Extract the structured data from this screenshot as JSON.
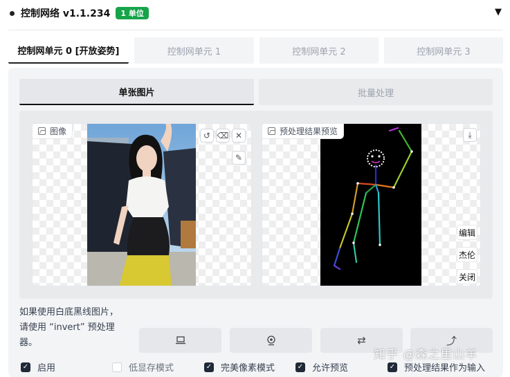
{
  "header": {
    "title": "控制网络 v1.1.234",
    "badge": "1 单位",
    "collapse_icon": "triangle-down-icon"
  },
  "unit_tabs": [
    {
      "label": "控制网单元 0 [开放姿势]",
      "active": true
    },
    {
      "label": "控制网单元 1",
      "active": false
    },
    {
      "label": "控制网单元 2",
      "active": false
    },
    {
      "label": "控制网单元 3",
      "active": false
    }
  ],
  "mode_tabs": [
    {
      "label": "单张图片",
      "active": true
    },
    {
      "label": "批量处理",
      "active": false
    }
  ],
  "input_image": {
    "label": "图像",
    "buttons": [
      "undo-icon",
      "eraser-icon",
      "close-icon",
      "brush-icon"
    ]
  },
  "preview_image": {
    "label": "预处理结果预览",
    "buttons": {
      "download": "download-icon",
      "edit": "编辑",
      "jielun": "杰伦",
      "close": "关闭"
    }
  },
  "hint": {
    "line1": "如果使用白底黑线图片，",
    "line2": "请使用 “invert” 预处理",
    "line3": "器。"
  },
  "action_buttons": [
    "laptop-icon",
    "camera-icon",
    "swap-icon",
    "arrow-up-icon"
  ],
  "options": [
    {
      "label": "启用",
      "checked": true
    },
    {
      "label": "低显存模式",
      "checked": false
    },
    {
      "label": "完美像素模式",
      "checked": true
    },
    {
      "label": "允许预览",
      "checked": true
    },
    {
      "label": "预处理结果作为输入",
      "checked": true
    }
  ],
  "watermark": "知乎 @森之里山羊",
  "colors": {
    "badge": "#16a34a",
    "panel": "#f3f4f6"
  }
}
